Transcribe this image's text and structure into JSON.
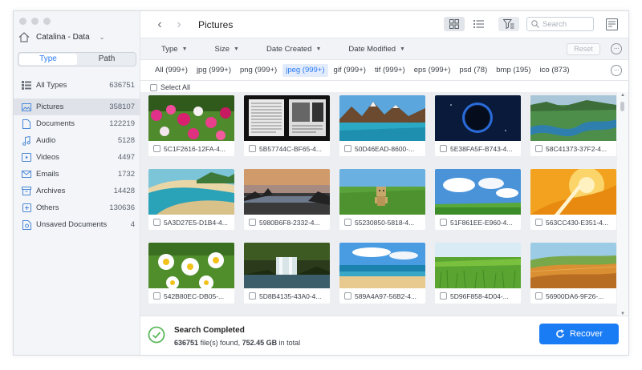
{
  "sidebar": {
    "drive_name": "Catalina - Data",
    "tabs": [
      {
        "label": "Type"
      },
      {
        "label": "Path"
      }
    ],
    "items": [
      {
        "label": "All Types",
        "count": "636751",
        "icon": "grid-icon"
      },
      {
        "label": "Pictures",
        "count": "358107",
        "icon": "image-icon"
      },
      {
        "label": "Documents",
        "count": "122219",
        "icon": "document-icon"
      },
      {
        "label": "Audio",
        "count": "5128",
        "icon": "music-icon"
      },
      {
        "label": "Videos",
        "count": "4497",
        "icon": "video-icon"
      },
      {
        "label": "Emails",
        "count": "1732",
        "icon": "email-icon"
      },
      {
        "label": "Archives",
        "count": "14428",
        "icon": "archive-icon"
      },
      {
        "label": "Others",
        "count": "130636",
        "icon": "others-icon"
      },
      {
        "label": "Unsaved Documents",
        "count": "4",
        "icon": "unsaved-icon"
      }
    ]
  },
  "header": {
    "title": "Pictures",
    "search_placeholder": "Search"
  },
  "filters": {
    "type_label": "Type",
    "size_label": "Size",
    "created_label": "Date Created",
    "modified_label": "Date Modified",
    "reset_label": "Reset"
  },
  "extensions": [
    {
      "label": "All (999+)"
    },
    {
      "label": "jpg (999+)"
    },
    {
      "label": "png (999+)"
    },
    {
      "label": "jpeg (999+)"
    },
    {
      "label": "gif (999+)"
    },
    {
      "label": "tif (999+)"
    },
    {
      "label": "eps (999+)"
    },
    {
      "label": "psd (78)"
    },
    {
      "label": "bmp (195)"
    },
    {
      "label": "ico (873)"
    }
  ],
  "select_all_label": "Select All",
  "files": [
    {
      "name": "5C1F2616-12FA-4...",
      "thumb": "flowers"
    },
    {
      "name": "5B57744C-BF65-4...",
      "thumb": "document"
    },
    {
      "name": "50D46EAD-8600-...",
      "thumb": "lake"
    },
    {
      "name": "5E38FA5F-B743-4...",
      "thumb": "eclipse"
    },
    {
      "name": "58C41373-37F2-4...",
      "thumb": "river"
    },
    {
      "name": "5A3D27E5-D1B4-4...",
      "thumb": "beach"
    },
    {
      "name": "5980B6F8-2332-4...",
      "thumb": "sunset"
    },
    {
      "name": "55230850-5818-4...",
      "thumb": "grass"
    },
    {
      "name": "51F861EE-E960-4...",
      "thumb": "sky"
    },
    {
      "name": "563CC430-E351-4...",
      "thumb": "orange"
    },
    {
      "name": "542B80EC-DB05-...",
      "thumb": "daisies"
    },
    {
      "name": "5D8B4135-43A0-4...",
      "thumb": "waterfall"
    },
    {
      "name": "589A4A97-56B2-4...",
      "thumb": "sea"
    },
    {
      "name": "5D96F858-4D04-...",
      "thumb": "field"
    },
    {
      "name": "56900DA6-9F26-...",
      "thumb": "hills"
    }
  ],
  "status": {
    "title": "Search Completed",
    "found_count": "636751",
    "found_text": "file(s) found,",
    "size": "752.45 GB",
    "size_suffix": "in total"
  },
  "recover_label": "Recover",
  "colors": {
    "accent": "#1a7cf5",
    "success": "#5cb85c"
  }
}
